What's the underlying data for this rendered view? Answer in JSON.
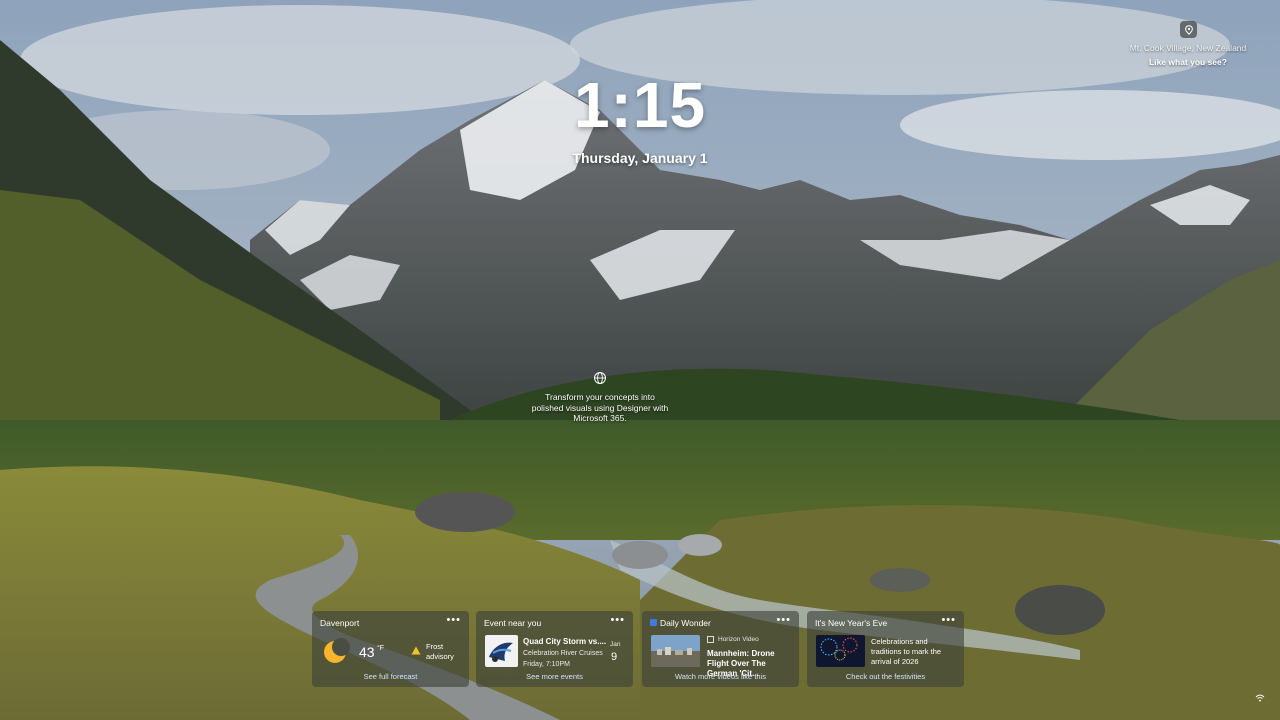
{
  "spotlight": {
    "location": "Mt. Cook Village, New Zealand",
    "like_text": "Like what you see?"
  },
  "lock": {
    "time": "1:15",
    "date": "Thursday, January 1"
  },
  "promo": {
    "text": "Transform your concepts into polished visuals using Designer with Microsoft 365."
  },
  "widgets": [
    {
      "title": "Davenport",
      "temp": "43",
      "unit": "°F",
      "alert": "Frost advisory",
      "link": "See full forecast"
    },
    {
      "title": "Event near you",
      "headline": "Quad City Storm vs....",
      "venue": "Celebration River Cruises",
      "when": "Friday, 7:10PM",
      "month": "Jan",
      "day": "9",
      "link": "See more events"
    },
    {
      "title": "Daily Wonder",
      "source": "Horizon Video",
      "headline": "Mannheim: Drone Flight Over The German 'Cit...",
      "link": "Watch more videos like this"
    },
    {
      "title": "It's New Year's Eve",
      "headline": "Celebrations and traditions to mark the arrival of 2026",
      "link": "Check out the festivities"
    }
  ],
  "menu_glyph": "•••",
  "colors": {
    "sun": "#f6b52a",
    "warning": "#f2c12e",
    "link": "#cfe3ff",
    "widget_bg": "#3e4238"
  },
  "icons": [
    "location-pin-icon",
    "globe-icon",
    "sun-icon",
    "warning-icon",
    "video-source-icon",
    "network-icon"
  ]
}
